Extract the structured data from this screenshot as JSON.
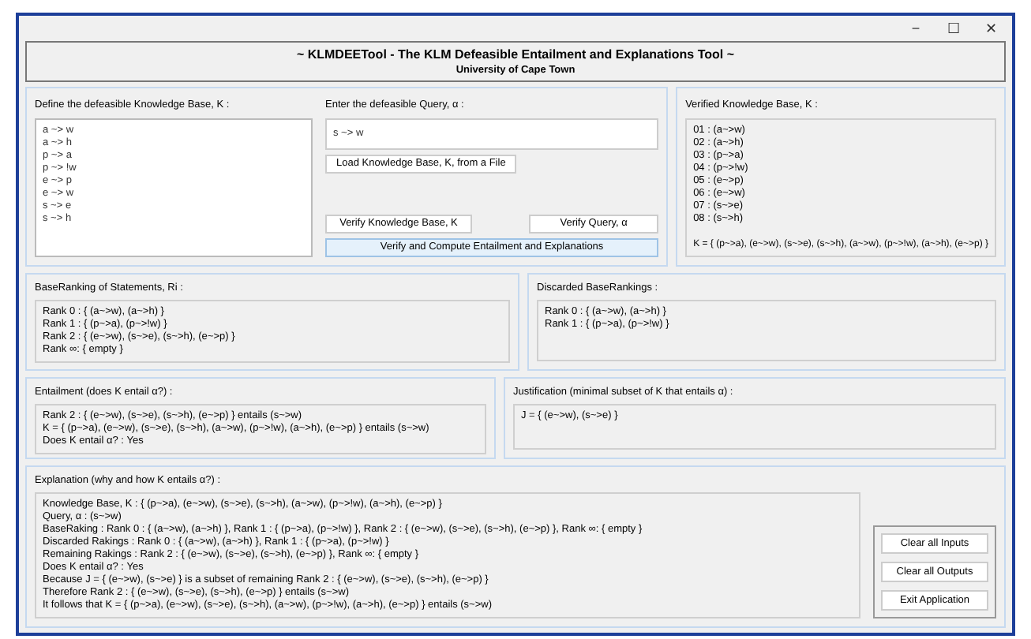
{
  "window": {
    "controls": [
      "−",
      "☐",
      "✕"
    ]
  },
  "header": {
    "title": "~ KLMDEETool - The KLM Defeasible Entailment and Explanations Tool ~",
    "subtitle": "University of Cape Town"
  },
  "knowledge_base": {
    "label": "Define the defeasible Knowledge Base, K :",
    "lines": [
      "a ~> w",
      "a ~> h",
      "p ~> a",
      "p ~> !w",
      "e ~> p",
      "e ~> w",
      "s ~> e",
      "s ~> h"
    ]
  },
  "query": {
    "label": "Enter the defeasible Query, α :",
    "value": "s ~> w",
    "load_button": "Load Knowledge Base, K, from a File",
    "verify_kb_button": "Verify Knowledge Base, K",
    "verify_query_button": "Verify Query, α",
    "compute_button": "Verify and Compute Entailment and Explanations"
  },
  "verified": {
    "label": "Verified Knowledge Base, K :",
    "lines": [
      "01 : (a~>w)",
      "02 : (a~>h)",
      "03 : (p~>a)",
      "04 : (p~>!w)",
      "05 : (e~>p)",
      "06 : (e~>w)",
      "07 : (s~>e)",
      "08 : (s~>h)"
    ],
    "summary": "K = { (p~>a), (e~>w), (s~>e), (s~>h), (a~>w), (p~>!w), (a~>h), (e~>p) }"
  },
  "base_ranking": {
    "label": "BaseRanking of Statements, Ri :",
    "lines": [
      "Rank 0 : { (a~>w), (a~>h) }",
      "Rank 1 : { (p~>a), (p~>!w) }",
      "Rank 2 : { (e~>w), (s~>e), (s~>h), (e~>p) }",
      "Rank ∞: { empty }"
    ]
  },
  "discarded": {
    "label": "Discarded BaseRankings :",
    "lines": [
      "Rank 0 : { (a~>w), (a~>h) }",
      "Rank 1 : { (p~>a), (p~>!w) }"
    ]
  },
  "entailment": {
    "label": "Entailment (does K entail α?) :",
    "lines": [
      "Rank 2 : { (e~>w), (s~>e), (s~>h), (e~>p) } entails (s~>w)",
      "K = { (p~>a), (e~>w), (s~>e), (s~>h), (a~>w), (p~>!w), (a~>h), (e~>p) } entails (s~>w)",
      "Does K entail α? : Yes"
    ]
  },
  "justification": {
    "label": "Justification (minimal subset of K that entails α) :",
    "lines": [
      "J = { (e~>w), (s~>e) }"
    ]
  },
  "explanation": {
    "label": "Explanation (why and how K entails α?) :",
    "lines": [
      "Knowledge Base, K : { (p~>a), (e~>w), (s~>e), (s~>h), (a~>w), (p~>!w), (a~>h), (e~>p) }",
      "Query, α : (s~>w)",
      "BaseRaking : Rank 0 : { (a~>w), (a~>h) }, Rank 1 : { (p~>a), (p~>!w) }, Rank 2 : { (e~>w), (s~>e), (s~>h), (e~>p) }, Rank ∞: { empty }",
      "Discarded Rakings : Rank 0 : { (a~>w), (a~>h) }, Rank 1 : { (p~>a), (p~>!w) }",
      "Remaining Rakings : Rank 2 : { (e~>w), (s~>e), (s~>h), (e~>p) }, Rank ∞: { empty }",
      "Does K entail α? : Yes",
      "Because J = { (e~>w), (s~>e) } is a subset of remaining Rank 2 : { (e~>w), (s~>e), (s~>h), (e~>p) }",
      "Therefore Rank 2 : { (e~>w), (s~>e), (s~>h), (e~>p) } entails (s~>w)",
      "It follows that K = { (p~>a), (e~>w), (s~>e), (s~>h), (a~>w), (p~>!w), (a~>h), (e~>p) } entails (s~>w)"
    ]
  },
  "actions": [
    "Clear all Inputs",
    "Clear all Outputs",
    "Exit Application"
  ]
}
